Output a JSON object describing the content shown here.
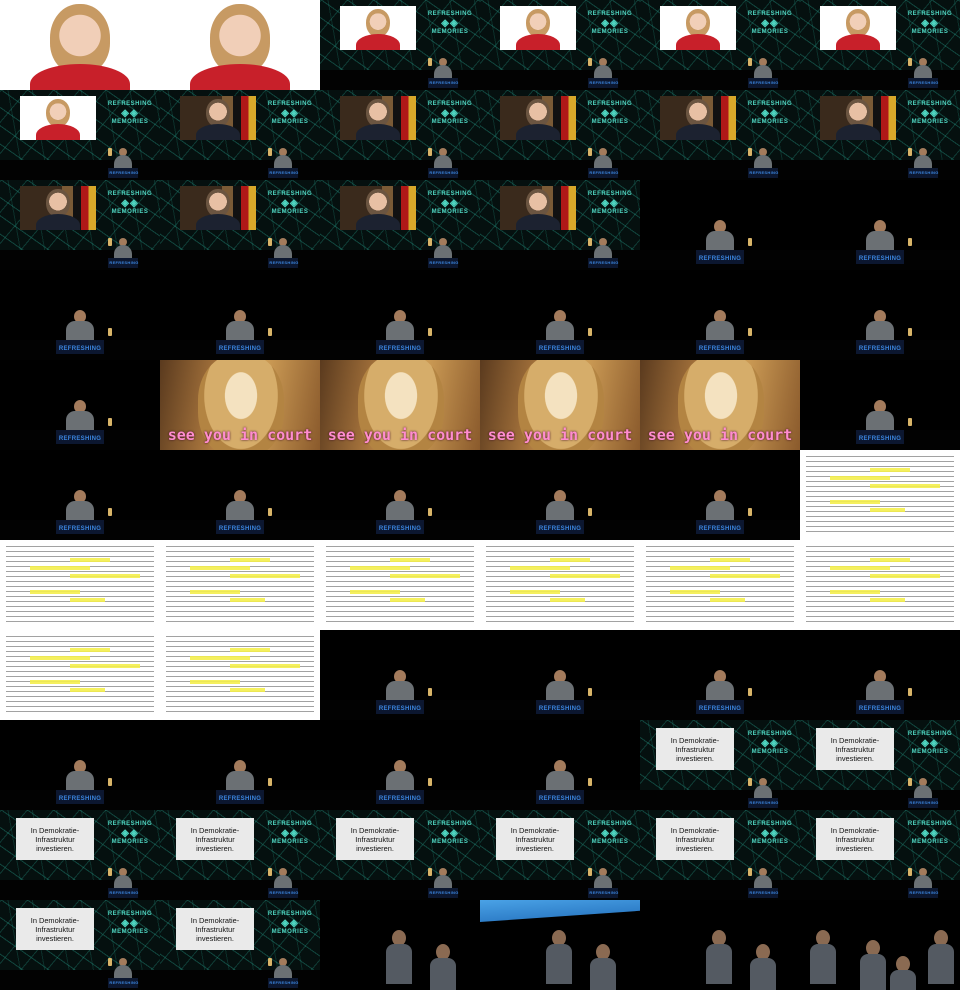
{
  "image": {
    "description_free": true,
    "columns": 6,
    "rows": 11,
    "stage_sign_text": "REFRESHING",
    "logo_lines": [
      "REFRESHING",
      "MEMORIES"
    ],
    "meme_caption": "see you in court",
    "slide_text": "In Demokratie-\nInfrastruktur\ninvestieren."
  },
  "tiles": [
    "portrait",
    "portrait",
    "net-woman",
    "net-woman",
    "net-woman",
    "net-woman",
    "net-woman",
    "net-man",
    "net-man",
    "net-man",
    "net-man",
    "net-man",
    "net-man",
    "net-man",
    "net-man",
    "net-man",
    "speaker",
    "speaker",
    "speaker",
    "speaker",
    "speaker",
    "speaker",
    "speaker",
    "speaker",
    "speaker",
    "meme",
    "meme",
    "meme",
    "meme",
    "speaker",
    "speaker",
    "speaker",
    "speaker",
    "speaker",
    "speaker",
    "doc",
    "doc",
    "doc",
    "doc",
    "doc",
    "doc",
    "doc",
    "doc",
    "doc",
    "speaker",
    "speaker",
    "speaker",
    "speaker",
    "speaker",
    "speaker",
    "speaker",
    "speaker",
    "slide",
    "slide",
    "slide",
    "slide",
    "slide",
    "slide",
    "slide",
    "slide",
    "slide",
    "slide",
    "audience",
    "audience",
    "audience",
    "audience"
  ]
}
